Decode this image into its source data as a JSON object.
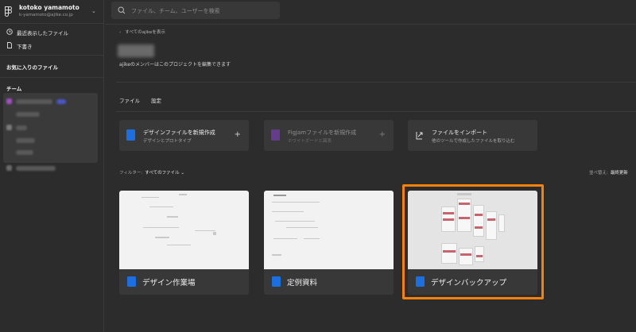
{
  "account": {
    "name": "kotoko yamamoto",
    "email": "k-yamamoto@ajike.co.jp"
  },
  "sidebar": {
    "recent": "最近表示したファイル",
    "drafts": "下書き",
    "favorites": "お気に入りのファイル",
    "team": "チーム"
  },
  "search": {
    "placeholder": "ファイル、チーム、ユーザーを検索"
  },
  "breadcrumb": {
    "label": "すべてのajikeを表示"
  },
  "project": {
    "permission_note": "ajikeのメンバーはこのプロジェクトを編集できます"
  },
  "tabs": [
    {
      "label": "ファイル"
    },
    {
      "label": "設定"
    }
  ],
  "actions": [
    {
      "title": "デザインファイルを新規作成",
      "subtitle": "デザインとプロトタイプ",
      "plus": "+"
    },
    {
      "title": "FigJamファイルを新規作成",
      "subtitle": "ホワイトボードと図表",
      "plus": "+"
    },
    {
      "title": "ファイルをインポート",
      "subtitle": "他のツールで作成したファイルを取り込む"
    }
  ],
  "filter": {
    "label": "フィルター:",
    "value": "すべてのファイル ⌄"
  },
  "sort": {
    "label": "並べ替え:",
    "value": "最終更新"
  },
  "files": [
    {
      "name": "デザイン作業場"
    },
    {
      "name": "定例資料"
    },
    {
      "name": "デザインバックアップ"
    }
  ],
  "colors": {
    "accent_highlight": "#f7820a",
    "design_file": "#1b6fe0",
    "figjam_file": "#8a3fd1"
  }
}
